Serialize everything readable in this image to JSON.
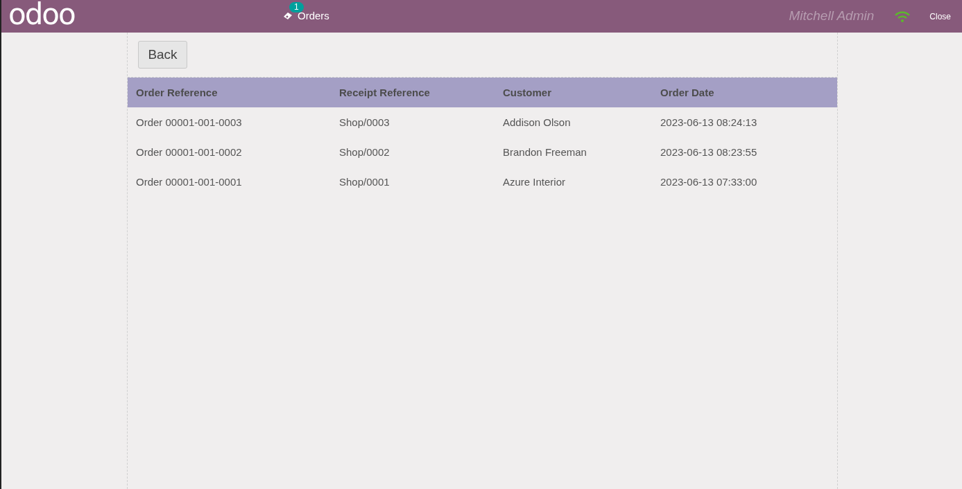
{
  "header": {
    "logo": "odoo",
    "orders_badge": "1",
    "orders_label": "Orders",
    "user": "Mitchell Admin",
    "close": "Close"
  },
  "back_button": "Back",
  "table": {
    "columns": [
      "Order Reference",
      "Receipt Reference",
      "Customer",
      "Order Date"
    ],
    "rows": [
      [
        "Order 00001-001-0003",
        "Shop/0003",
        "Addison Olson",
        "2023-06-13 08:24:13"
      ],
      [
        "Order 00001-001-0002",
        "Shop/0002",
        "Brandon Freeman",
        "2023-06-13 08:23:55"
      ],
      [
        "Order 00001-001-0001",
        "Shop/0001",
        "Azure Interior",
        "2023-06-13 07:33:00"
      ]
    ]
  }
}
